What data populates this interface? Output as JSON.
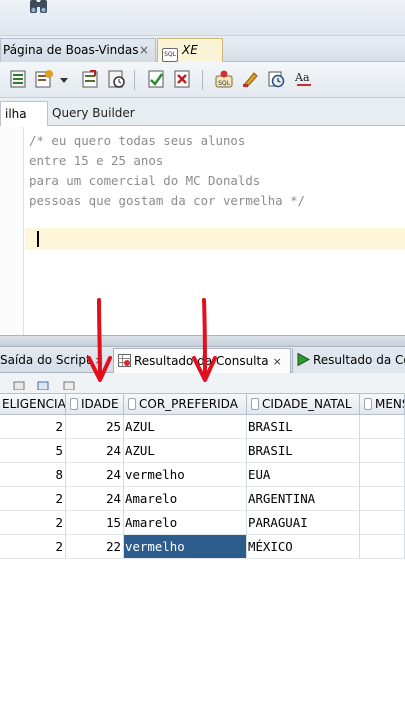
{
  "window": {
    "icon": "binoculars-icon"
  },
  "doc_tabs": [
    {
      "label": "Página de Boas-Vindas",
      "close": "×"
    },
    {
      "label": "XE",
      "icon": "sql-worksheet-icon",
      "icon_text": "SQL"
    }
  ],
  "toolbar": {
    "icons": [
      "run-statement-icon",
      "run-script-icon",
      "dropdown-icon",
      "commit-icon",
      "rollback-icon",
      "explain-plan-icon",
      "autotrace-icon",
      "sql-tuning-icon",
      "clear-icon",
      "history-icon",
      "format-icon"
    ]
  },
  "subtabs": {
    "worksheet": "ilha",
    "query_builder": "Query Builder"
  },
  "editor": {
    "lines": [
      "/* eu quero todas seus alunos",
      "entre 15 e 25 anos",
      "para um comercial do MC Donalds",
      "pessoas que gostam da cor vermelha */"
    ]
  },
  "bottom_tabs": {
    "script_output": "Saída do Script",
    "query_result": "Resultado da Consulta",
    "query_result_2": "Resultado da Co",
    "close": "×"
  },
  "grid": {
    "columns": [
      "ELIGENCIA",
      "IDADE",
      "COR_PREFERIDA",
      "CIDADE_NATAL",
      "MENS"
    ],
    "rows": [
      [
        "2",
        "25",
        "AZUL",
        "BRASIL"
      ],
      [
        "5",
        "24",
        "AZUL",
        "BRASIL"
      ],
      [
        "8",
        "24",
        "vermelho",
        "EUA"
      ],
      [
        "2",
        "24",
        "Amarelo",
        "ARGENTINA"
      ],
      [
        "2",
        "15",
        "Amarelo",
        "PARAGUAI"
      ],
      [
        "2",
        "22",
        "vermelho",
        "MÉXICO"
      ]
    ],
    "selected_row": 5,
    "selected_col": 2
  },
  "annotations": {
    "arrow_color": "#e0101e"
  },
  "colors": {
    "selection": "#2c5d8c",
    "current_line": "#fdf6d9",
    "comment_text": "#8c8c8c"
  }
}
